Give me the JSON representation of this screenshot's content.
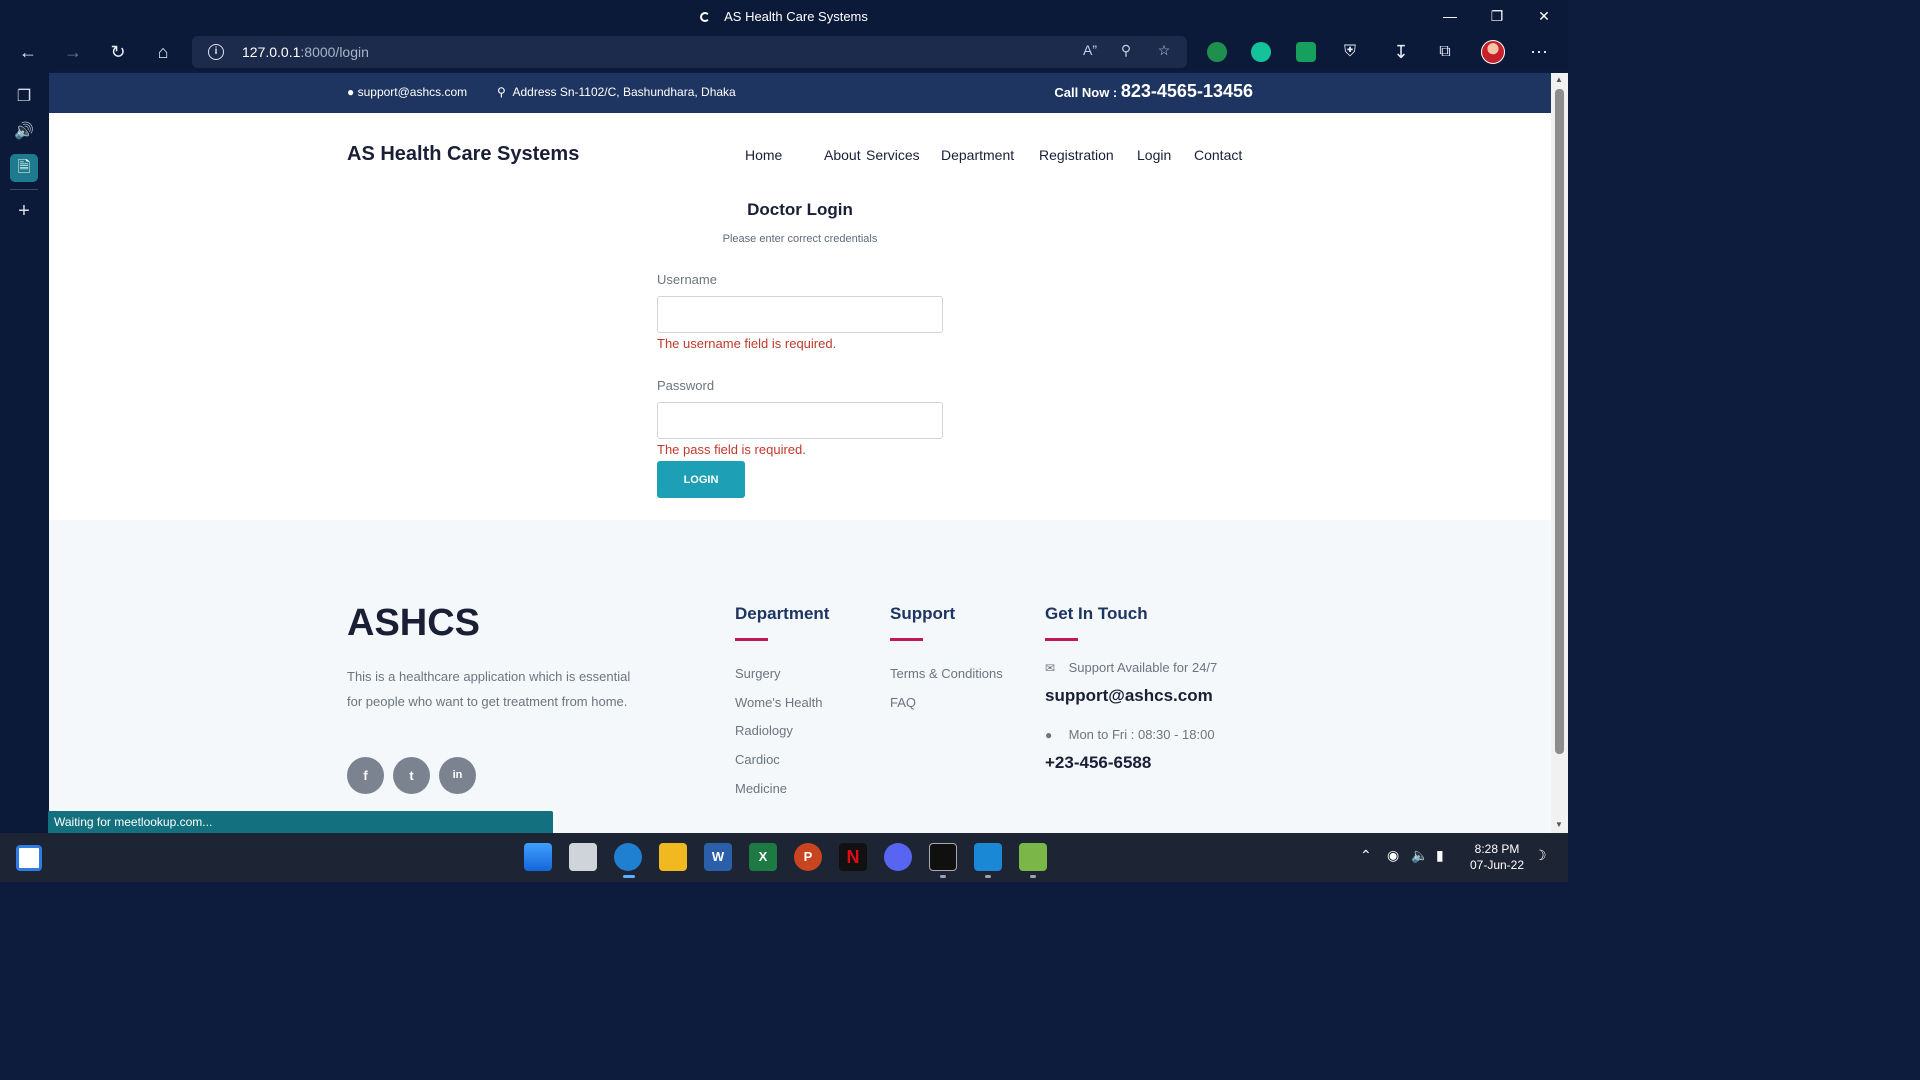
{
  "window": {
    "title": "AS Health Care Systems"
  },
  "browser": {
    "url_host": "127.0.0.1",
    "url_rest": ":8000/login",
    "status_text": "Waiting for meetlookup.com..."
  },
  "topbar": {
    "email": "support@ashcs.com",
    "address": "Address Sn-1102/C, Bashundhara, Dhaka",
    "call_label": "Call Now : ",
    "call_number": "823-4565-13456"
  },
  "navbar": {
    "brand": "AS Health Care Systems",
    "links": [
      "Home",
      "About",
      "Services",
      "Department",
      "Registration",
      "Login",
      "Contact"
    ]
  },
  "login": {
    "title": "Doctor Login",
    "subtitle": "Please enter correct credentials",
    "username_label": "Username",
    "username_value": "",
    "username_error": "The username field is required.",
    "password_label": "Password",
    "password_value": "",
    "password_error": "The pass field is required.",
    "submit_label": "LOGIN"
  },
  "footer": {
    "brand": "ASHCS",
    "about": "This is a healthcare application which is essential for people who want to get treatment from home.",
    "social": [
      "f",
      "t",
      "in"
    ],
    "department": {
      "heading": "Department",
      "links": [
        "Surgery",
        "Wome's Health",
        "Radiology",
        "Cardioc",
        "Medicine"
      ]
    },
    "support": {
      "heading": "Support",
      "links": [
        "Terms & Conditions",
        "FAQ"
      ]
    },
    "contact": {
      "heading": "Get In Touch",
      "support_note": "Support Available for 24/7",
      "email": "support@ashcs.com",
      "hours": "Mon to Fri : 08:30 - 18:00",
      "phone": "+23-456-6588"
    }
  },
  "taskbar": {
    "time": "8:28 PM",
    "date": "07-Jun-22"
  },
  "colors": {
    "topbar_bg": "#1e3561",
    "accent_button": "#1d9fb5",
    "error_text": "#c0392b",
    "footer_underline": "#c2185b"
  }
}
